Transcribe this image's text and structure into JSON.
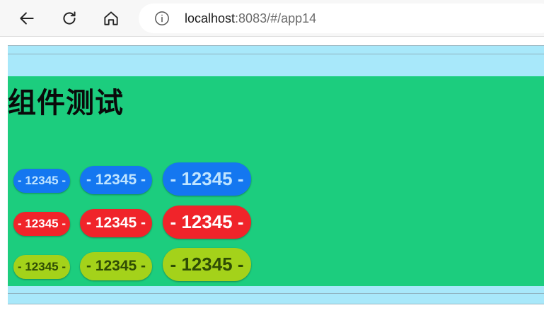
{
  "browser": {
    "url_host": "localhost",
    "url_rest": ":8083/#/app14"
  },
  "page": {
    "title": "组件测试"
  },
  "buttons": {
    "blue": {
      "small": "- 12345 -",
      "medium": "- 12345 -",
      "large": "- 12345 -"
    },
    "red": {
      "small": "- 12345 -",
      "medium": "- 12345 -",
      "large": "- 12345 -"
    },
    "lime": {
      "small": "- 12345 -",
      "medium": "- 12345 -",
      "large": "- 12345 -"
    }
  },
  "colors": {
    "panel": "#1ccd7e",
    "strip": "#a8e8fa",
    "blue_pill": "#1477f0",
    "red_pill": "#f0242a",
    "lime_pill": "#a4d21a"
  },
  "icons": [
    "back-arrow-icon",
    "reload-icon",
    "home-icon",
    "info-icon"
  ]
}
